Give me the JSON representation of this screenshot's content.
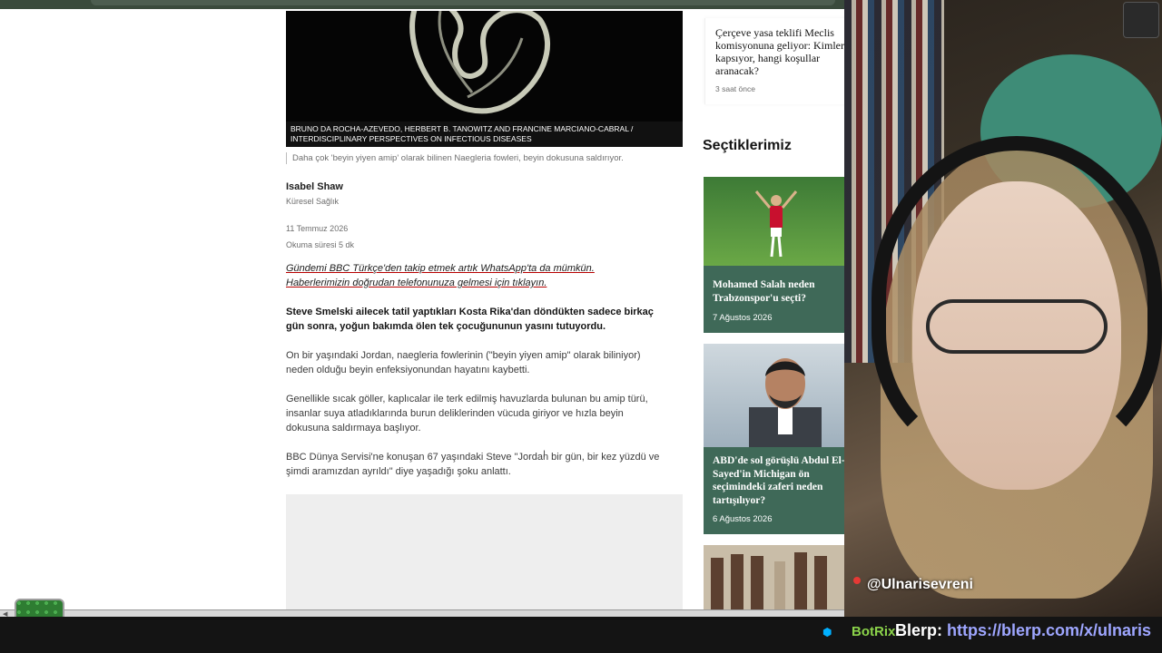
{
  "article": {
    "image_credit": "BRUNO DA ROCHA-AZEVEDO, HERBERT B. TANOWITZ AND FRANCINE MARCIANO-CABRAL / INTERDISCIPLINARY PERSPECTIVES ON INFECTIOUS DISEASES",
    "image_caption": "Daha çok 'beyin yiyen amip' olarak bilinen Naegleria fowleri, beyin dokusuna saldırıyor.",
    "author_name": "Isabel Shaw",
    "author_role": "Küresel Sağlık",
    "date": "11 Temmuz 2026",
    "read_time": "Okuma süresi 5 dk",
    "promo_line1": "Gündemi BBC Türkçe'den takip etmek artık WhatsApp'ta da mümkün.",
    "promo_line2": "Haberlerimizin doğrudan telefonunuza gelmesi için tıklayın.",
    "paragraphs": [
      "Steve Smelski ailecek tatil yaptıkları Kosta Rika'dan döndükten sadece birkaç gün sonra, yoğun bakımda ölen tek çocuğununun yasını tutuyordu.",
      "On bir yaşındaki Jordan, naegleria fowlerinin (\"beyin yiyen amip\" olarak biliniyor) neden olduğu beyin enfeksiyonundan hayatını kaybetti.",
      "Genellikle sıcak göller, kaplıcalar ile terk edilmiş havuzlarda bulunan bu amip türü, insanlar suya atladıklarında burun deliklerinden vücuda giriyor ve hızla beyin dokusuna saldırmaya başlıyor.",
      "BBC Dünya Servisi'ne konuşan 67 yaşındaki Steve \"Jordan bir gün, bir kez yüzdü ve şimdi aramızdan ayrıldı\" diye yaşadığı şoku anlattı."
    ]
  },
  "sidebar": {
    "top_card": {
      "title": "Çerçeve yasa teklifi Meclis komisyonuna geliyor: Kimleri kapsıyor, hangi koşullar aranacak?",
      "time": "3 saat önce"
    },
    "section_title": "Seçtiklerimiz",
    "picks": [
      {
        "title": "Mohamed Salah neden Trabzonspor'u seçti?",
        "date": "7 Ağustos 2026"
      },
      {
        "title": "ABD'de sol görüşlü Abdul El-Sayed'in Michigan ön seçimindeki zaferi neden tartışılıyor?",
        "date": "6 Ağustos 2026"
      }
    ]
  },
  "stream": {
    "handle": "@Ulnarisevreni",
    "bot_name": "BotRix",
    "bot_message_prefix": "Blerp:",
    "bot_message_link": "https://blerp.com/x/ulnaris"
  },
  "icons": {
    "record": "record-dot-icon",
    "trash": "recycle-bin-icon",
    "bot": "bot-icon"
  },
  "colors": {
    "section_accent": "#3f6958",
    "promo_underline": "#b80000",
    "bot_name": "#8bd34a",
    "link": "#9ea6ff"
  }
}
